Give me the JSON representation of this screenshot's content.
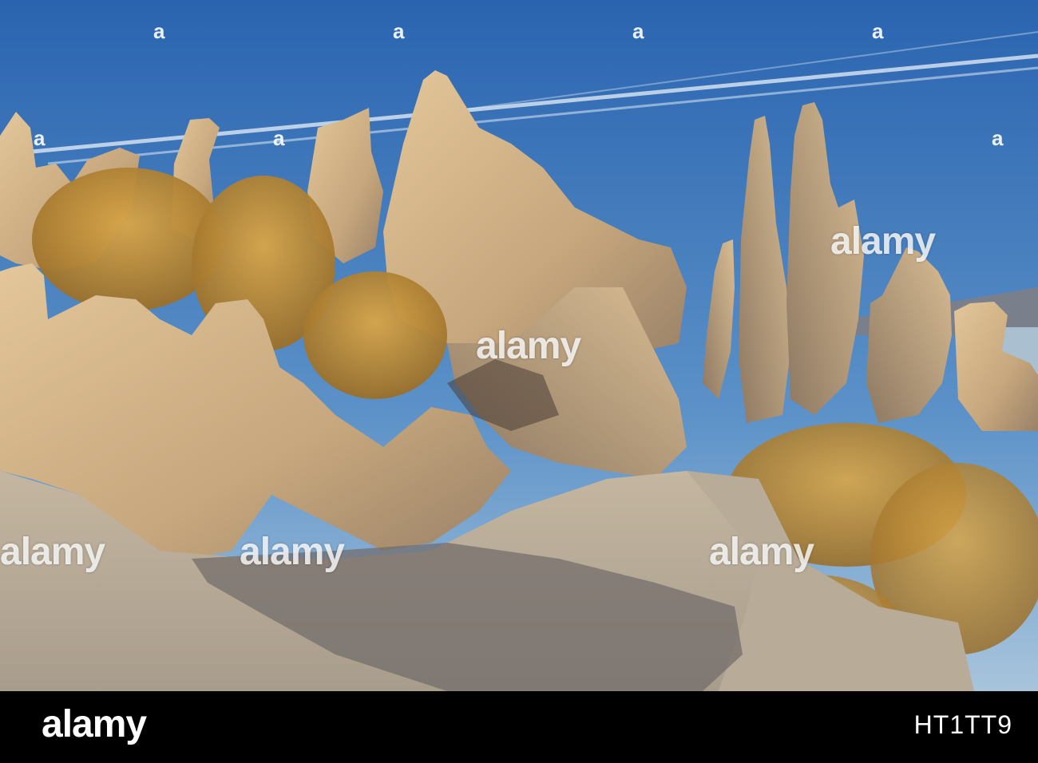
{
  "watermark": {
    "text": "alamy",
    "small_mark": "a"
  },
  "footer": {
    "brand": "alamy",
    "image_code": "HT1TT9"
  },
  "colors": {
    "sky_top": "#2f6fb8",
    "sky_bottom": "#8fb6d8",
    "tufa_light": "#d8b98e",
    "tufa_shadow": "#8a7560",
    "shrub": "#c9953a",
    "ground": "#b8ab98",
    "ground_shadow": "#6f6a68",
    "footer_bg": "#000000"
  }
}
